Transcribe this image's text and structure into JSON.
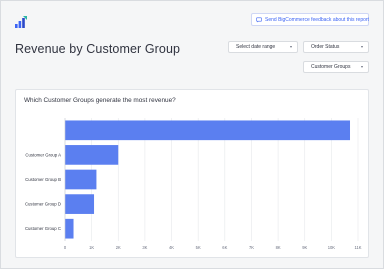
{
  "header": {
    "feedback_label": "Send BigCommerce feedback about this report"
  },
  "page": {
    "title": "Revenue by Customer Group"
  },
  "filters": {
    "date_range": "Select date range",
    "order_status": "Order Status",
    "customer_groups": "Customer Groups"
  },
  "colors": {
    "bar": "#5b7ff0",
    "accent": "#3c64f4",
    "grid": "#e6e8eb"
  },
  "chart_data": {
    "type": "bar",
    "orientation": "horizontal",
    "title": "Which Customer Groups generate the most revenue?",
    "categories": [
      "",
      "Customer Group A",
      "Customer Group B",
      "Customer Group D",
      "Customer Group C"
    ],
    "values": [
      10700,
      2000,
      1180,
      1090,
      320
    ],
    "xlim": [
      0,
      11000
    ],
    "ticks": [
      "0",
      "1K",
      "2K",
      "3K",
      "4K",
      "5K",
      "6K",
      "7K",
      "8K",
      "9K",
      "10K",
      "11K"
    ],
    "grid": true
  }
}
